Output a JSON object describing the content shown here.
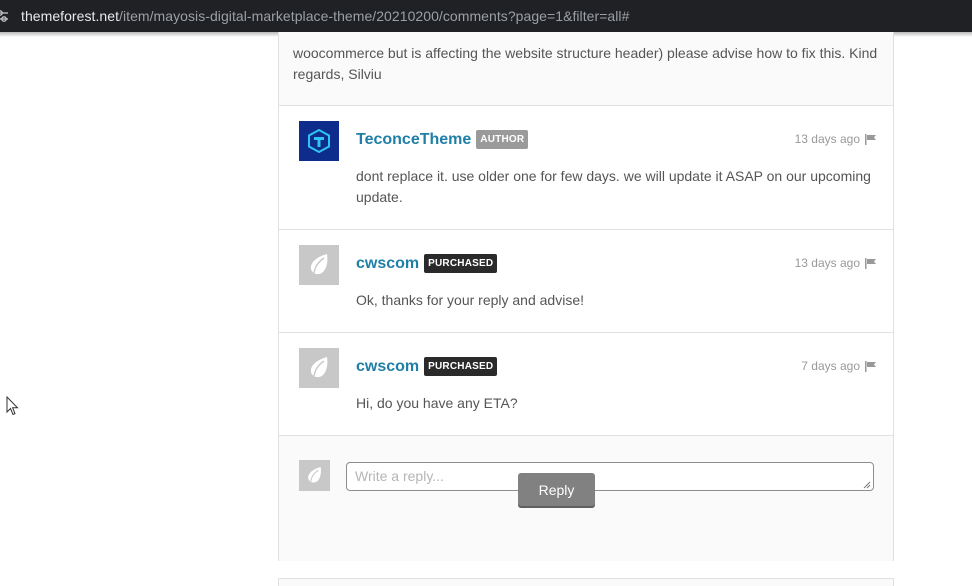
{
  "browser": {
    "url_domain": "themeforest.net",
    "url_path": "/item/mayosis-digital-marketplace-theme/20210200/comments?page=1&filter=all#"
  },
  "thread": {
    "top_text": "woocommerce but is affecting the website structure header) please advise how to fix this. Kind regards, Silviu"
  },
  "replies": [
    {
      "username": "TeconceTheme",
      "badge": "AUTHOR",
      "time": "13 days ago",
      "text": "dont replace it. use older one for few days. we will update it ASAP on our upcoming update."
    },
    {
      "username": "cwscom",
      "badge": "PURCHASED",
      "time": "13 days ago",
      "text": "Ok, thanks for your reply and advise!"
    },
    {
      "username": "cwscom",
      "badge": "PURCHASED",
      "time": "7 days ago",
      "text": "Hi, do you have any ETA?"
    }
  ],
  "reply_form": {
    "placeholder": "Write a reply...",
    "button_label": "Reply"
  },
  "colors": {
    "username": "#1f7fa6",
    "author_badge": "#9a9a9a",
    "purchased_badge": "#2a2a2a",
    "reply_button": "#818181"
  },
  "icons": [
    "site-info-icon",
    "teconce-logo-icon",
    "envato-leaf-icon",
    "flag-icon",
    "mouse-cursor-icon"
  ]
}
